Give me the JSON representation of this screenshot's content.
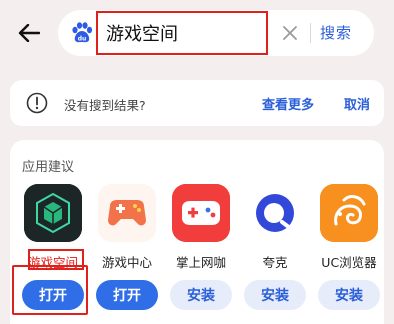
{
  "header": {
    "back_icon": "back-arrow-icon",
    "logo_icon": "baidu-paw-icon",
    "search_value": "游戏空间",
    "clear_icon": "clear-x-icon",
    "search_button": "搜索"
  },
  "notice": {
    "icon": "info-icon",
    "text": "没有搜到结果?",
    "view_more": "查看更多",
    "cancel": "取消"
  },
  "suggestions": {
    "title": "应用建议",
    "apps": [
      {
        "name": "游戏空间",
        "button": "打开",
        "action": "open",
        "highlighted": true,
        "icon": "game-space-icon"
      },
      {
        "name": "游戏中心",
        "button": "打开",
        "action": "open",
        "highlighted": false,
        "icon": "game-center-icon"
      },
      {
        "name": "掌上网咖",
        "button": "安装",
        "action": "install",
        "highlighted": false,
        "icon": "gamepad-icon"
      },
      {
        "name": "夸克",
        "button": "安装",
        "action": "install",
        "highlighted": false,
        "icon": "quark-icon"
      },
      {
        "name": "UC浏览器",
        "button": "安装",
        "action": "install",
        "highlighted": false,
        "icon": "uc-squirrel-icon"
      }
    ]
  },
  "colors": {
    "accent_blue": "#2f6ee6",
    "link_blue": "#2b5fd9",
    "highlight_red": "#e0201a",
    "background": "#f4eeef"
  }
}
